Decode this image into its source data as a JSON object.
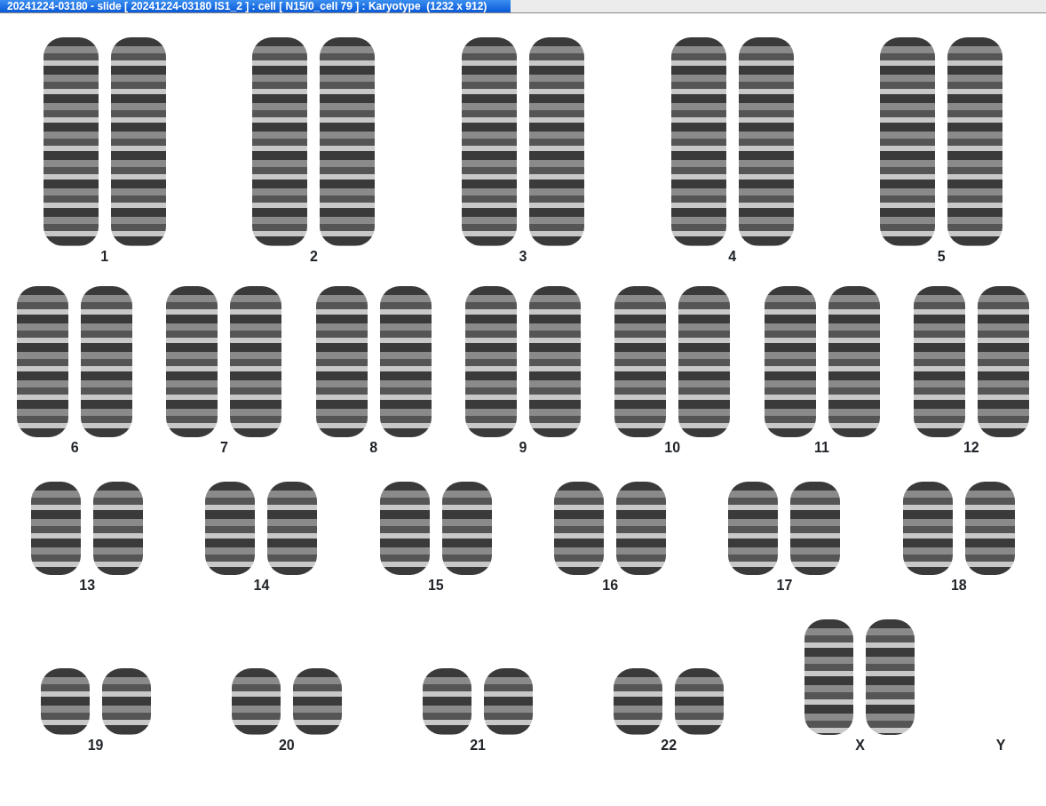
{
  "window": {
    "title": "20241224-03180 - slide [ 20241224-03180 IS1_2 ] : cell [ N15/0_cell 79 ] : Karyotype  (1232 x 912)"
  },
  "karyotype": {
    "rows": [
      {
        "groups": [
          {
            "label": "1",
            "kind": "pair"
          },
          {
            "label": "2",
            "kind": "pair"
          },
          {
            "label": "3",
            "kind": "pair"
          },
          {
            "label": "4",
            "kind": "pair"
          },
          {
            "label": "5",
            "kind": "pair"
          }
        ]
      },
      {
        "groups": [
          {
            "label": "6",
            "kind": "pair"
          },
          {
            "label": "7",
            "kind": "pair"
          },
          {
            "label": "8",
            "kind": "pair"
          },
          {
            "label": "9",
            "kind": "pair"
          },
          {
            "label": "10",
            "kind": "pair"
          },
          {
            "label": "11",
            "kind": "pair"
          },
          {
            "label": "12",
            "kind": "pair"
          }
        ]
      },
      {
        "groups": [
          {
            "label": "13",
            "kind": "pair"
          },
          {
            "label": "14",
            "kind": "pair"
          },
          {
            "label": "15",
            "kind": "pair"
          },
          {
            "label": "16",
            "kind": "pair"
          },
          {
            "label": "17",
            "kind": "pair"
          },
          {
            "label": "18",
            "kind": "pair"
          }
        ]
      },
      {
        "groups": [
          {
            "label": "19",
            "kind": "pair"
          },
          {
            "label": "20",
            "kind": "pair"
          },
          {
            "label": "21",
            "kind": "pair"
          },
          {
            "label": "22",
            "kind": "pair"
          },
          {
            "label": "X",
            "kind": "pair"
          },
          {
            "label": "Y",
            "kind": "none"
          }
        ]
      }
    ]
  }
}
